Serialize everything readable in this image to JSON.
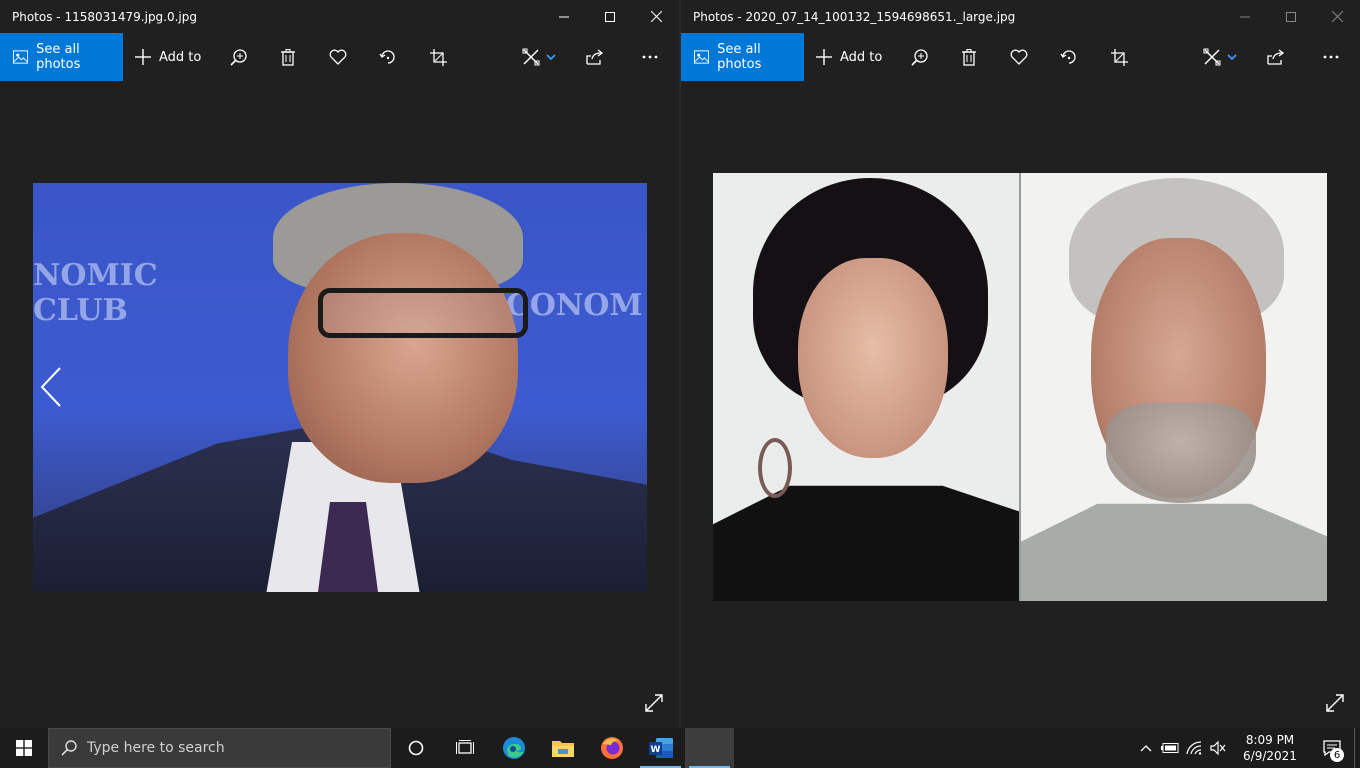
{
  "windows": [
    {
      "title": "Photos - 1158031479.jpg.0.jpg",
      "toolbar": {
        "see_all": "See all photos",
        "add_to": "Add to"
      }
    },
    {
      "title": "Photos - 2020_07_14_100132_1594698651._large.jpg",
      "toolbar": {
        "see_all": "See all photos",
        "add_to": "Add to"
      }
    }
  ],
  "left_photo": {
    "banner_left": "NOMIC CLUB",
    "banner_right": "E ECONOM"
  },
  "icons": {
    "toolbar": [
      "image-icon",
      "plus-icon",
      "zoom-icon",
      "trash-icon",
      "heart-icon",
      "rotate-icon",
      "crop-icon",
      "edit-icon",
      "chevron-down-icon",
      "share-icon",
      "more-icon"
    ],
    "caption": [
      "minimize-icon",
      "maximize-icon",
      "close-icon"
    ],
    "viewer": [
      "chevron-left-icon",
      "fullscreen-icon"
    ],
    "taskbar": [
      "windows-logo-icon",
      "search-icon",
      "cortana-icon",
      "task-view-icon",
      "edge-icon",
      "file-explorer-icon",
      "firefox-icon",
      "word-icon"
    ],
    "tray": [
      "chevron-up-icon",
      "battery-icon",
      "wifi-icon",
      "volume-muted-icon",
      "notification-icon"
    ]
  },
  "colors": {
    "accent": "#0078d7",
    "window_bg": "#202020",
    "taskbar_bg": "#1c1c1c"
  },
  "taskbar": {
    "search_placeholder": "Type here to search",
    "clock_time": "8:09 PM",
    "clock_date": "6/9/2021",
    "notification_count": "6"
  }
}
